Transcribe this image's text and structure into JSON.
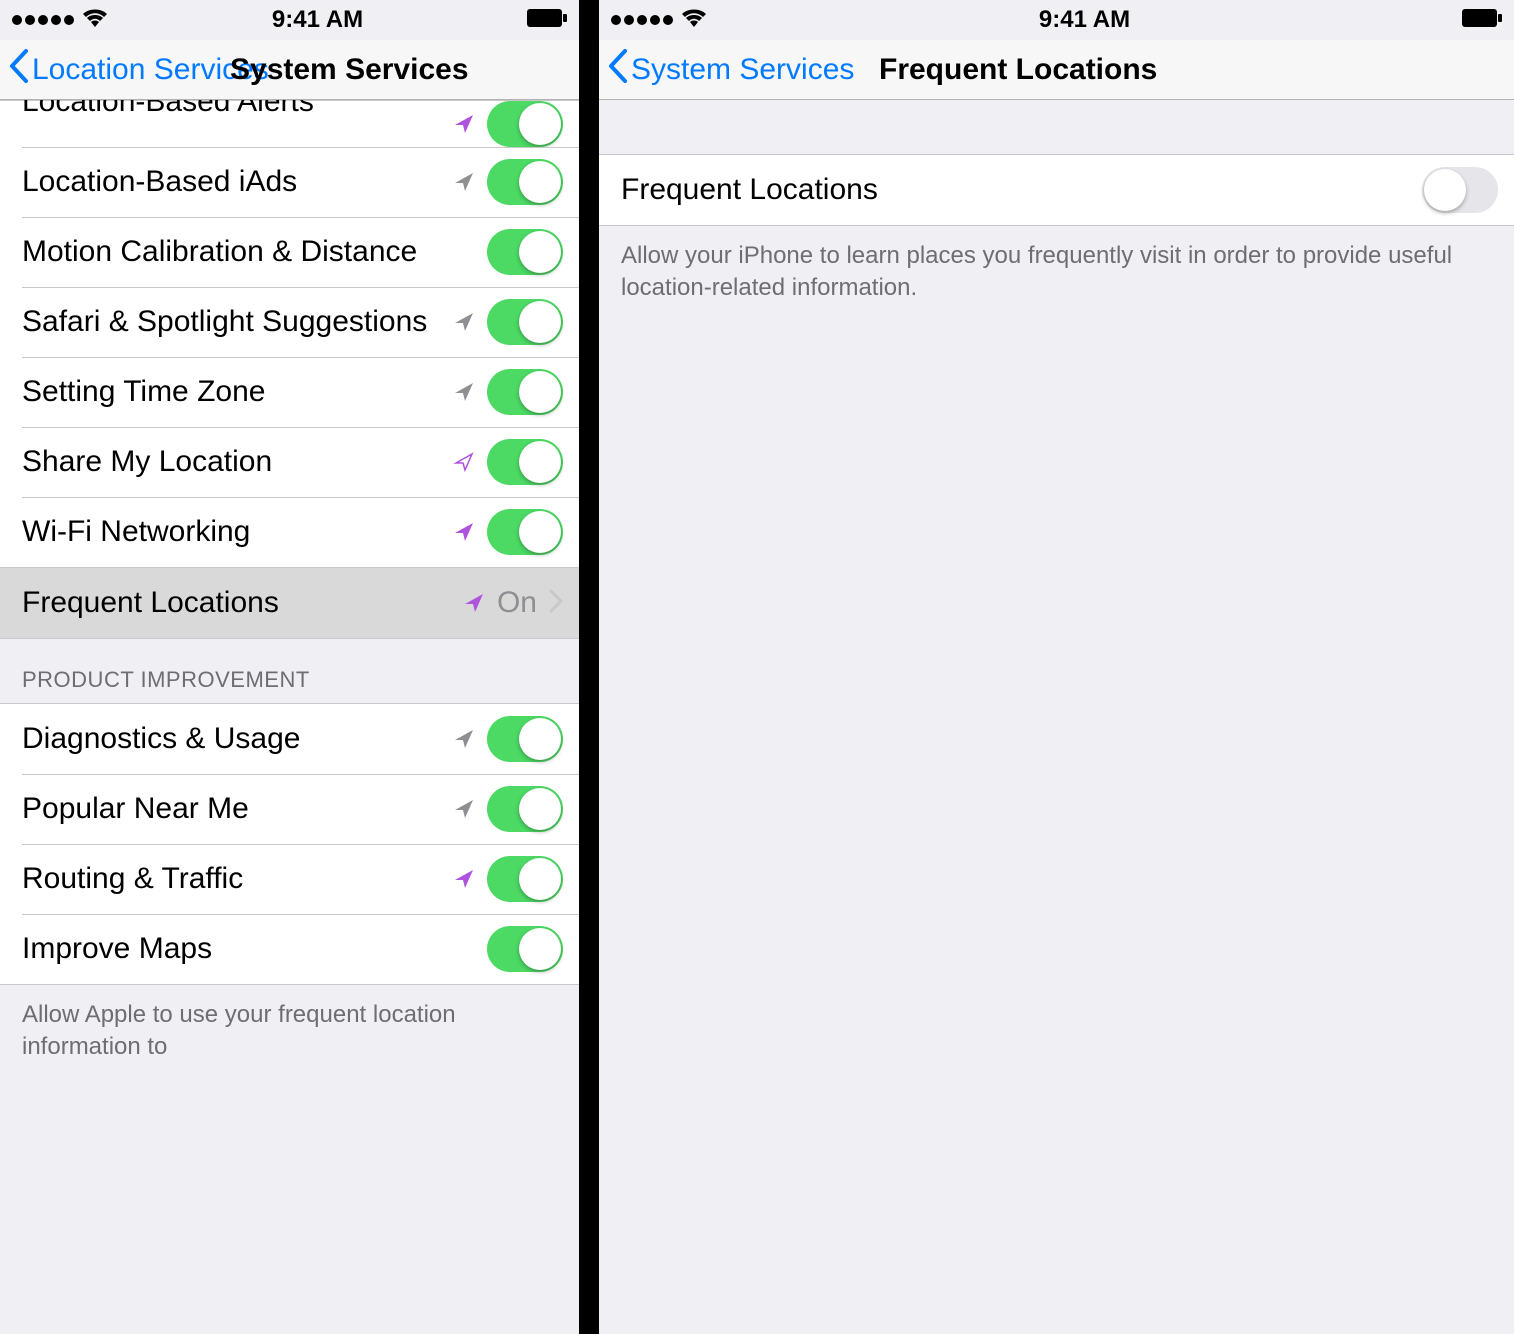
{
  "status": {
    "time": "9:41 AM"
  },
  "left": {
    "back": "Location Services",
    "title": "System Services",
    "rows1": [
      {
        "label": "Location-Based Alerts",
        "arrow": "purple",
        "switch": "on",
        "cutoff": true
      },
      {
        "label": "Location-Based iAds",
        "arrow": "gray",
        "switch": "on"
      },
      {
        "label": "Motion Calibration & Distance",
        "arrow": "",
        "switch": "on"
      },
      {
        "label": "Safari & Spotlight Suggestions",
        "arrow": "gray",
        "switch": "on"
      },
      {
        "label": "Setting Time Zone",
        "arrow": "gray",
        "switch": "on"
      },
      {
        "label": "Share My Location",
        "arrow": "purple-outline",
        "switch": "on"
      },
      {
        "label": "Wi-Fi Networking",
        "arrow": "purple",
        "switch": "on"
      }
    ],
    "row_nav": {
      "label": "Frequent Locations",
      "arrow": "purple",
      "value": "On"
    },
    "section2_header": "PRODUCT IMPROVEMENT",
    "rows2": [
      {
        "label": "Diagnostics & Usage",
        "arrow": "gray",
        "switch": "on"
      },
      {
        "label": "Popular Near Me",
        "arrow": "gray",
        "switch": "on"
      },
      {
        "label": "Routing & Traffic",
        "arrow": "purple",
        "switch": "on"
      },
      {
        "label": "Improve Maps",
        "arrow": "",
        "switch": "on"
      }
    ],
    "footer2": "Allow Apple to use your frequent location information to"
  },
  "right": {
    "back": "System Services",
    "title": "Frequent Locations",
    "row": {
      "label": "Frequent Locations",
      "switch": "off"
    },
    "footer": "Allow your iPhone to learn places you frequently visit in order to provide useful location-related information."
  }
}
